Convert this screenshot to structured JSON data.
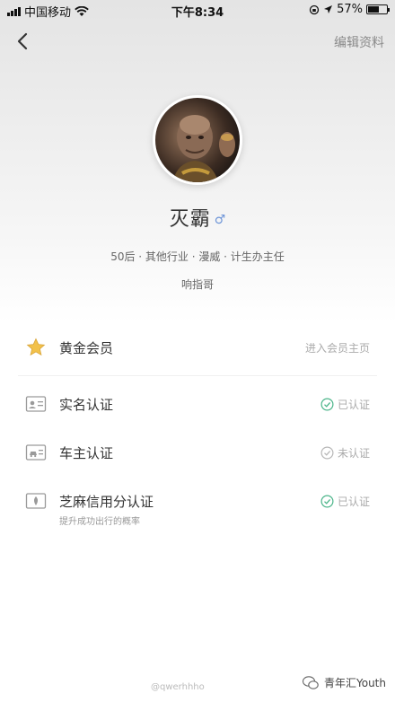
{
  "status_bar": {
    "carrier": "中国移动",
    "time": "下午8:34",
    "battery": "57%"
  },
  "nav": {
    "edit_label": "编辑资料"
  },
  "profile": {
    "name": "灭霸",
    "gender_symbol": "♂",
    "tags": "50后 · 其他行业 · 漫威 · 计生办主任",
    "nickname": "响指哥"
  },
  "list": {
    "gold_member": {
      "label": "黄金会员",
      "action": "进入会员主页"
    },
    "real_name": {
      "label": "实名认证",
      "status": "已认证"
    },
    "car_owner": {
      "label": "车主认证",
      "status": "未认证"
    },
    "sesame_credit": {
      "label": "芝麻信用分认证",
      "status": "已认证",
      "sub": "提升成功出行的概率"
    }
  },
  "colors": {
    "verified": "#4cb58a",
    "unverified": "#b8b8b8",
    "star": "#f2c14a"
  },
  "watermark": {
    "weibo": "@qwerhhho",
    "wechat": "青年汇Youth"
  }
}
